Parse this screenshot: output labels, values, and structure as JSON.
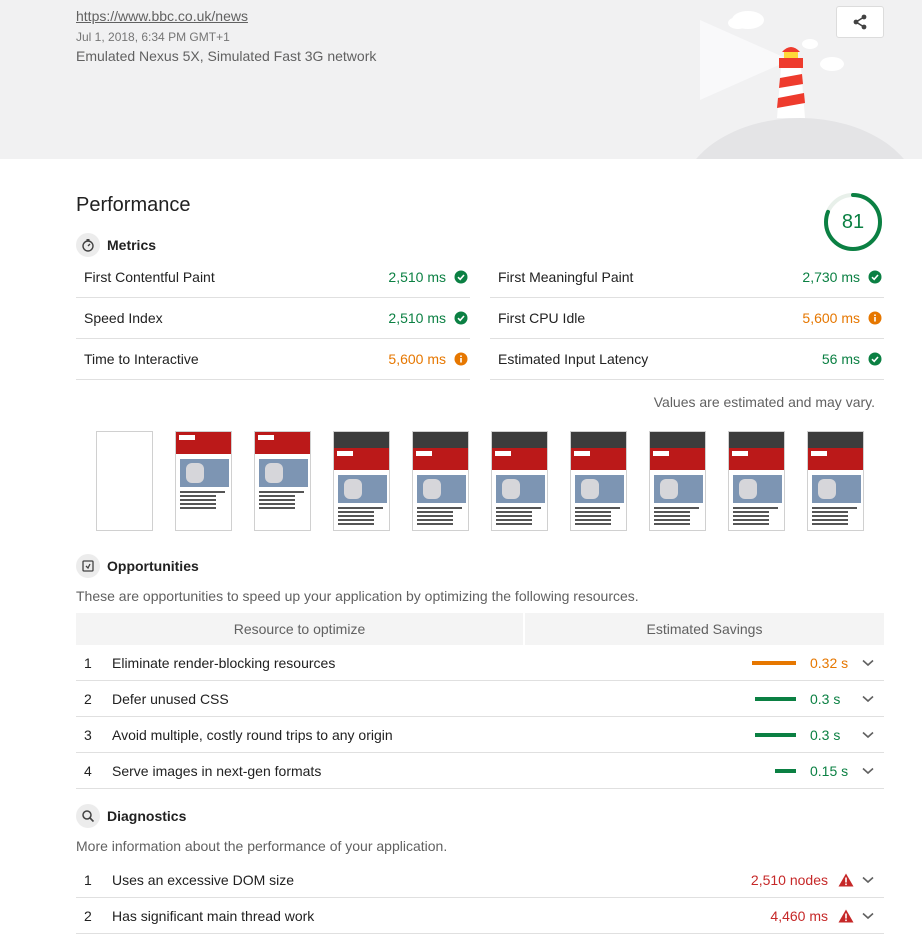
{
  "header": {
    "url": "https://www.bbc.co.uk/news",
    "date": "Jul 1, 2018, 6:34 PM GMT+1",
    "environment": "Emulated Nexus 5X, Simulated Fast 3G network"
  },
  "performance": {
    "title": "Performance",
    "score": "81",
    "score_fraction": 0.81,
    "score_color": "#0b8043"
  },
  "metrics": {
    "title": "Metrics",
    "items": [
      {
        "label": "First Contentful Paint",
        "value": "2,510 ms",
        "status": "pass"
      },
      {
        "label": "First Meaningful Paint",
        "value": "2,730 ms",
        "status": "pass"
      },
      {
        "label": "Speed Index",
        "value": "2,510 ms",
        "status": "pass"
      },
      {
        "label": "First CPU Idle",
        "value": "5,600 ms",
        "status": "average"
      },
      {
        "label": "Time to Interactive",
        "value": "5,600 ms",
        "status": "average"
      },
      {
        "label": "Estimated Input Latency",
        "value": "56 ms",
        "status": "pass"
      }
    ],
    "note": "Values are estimated and may vary."
  },
  "filmstrip": {
    "frames": 10
  },
  "opportunities": {
    "title": "Opportunities",
    "description": "These are opportunities to speed up your application by optimizing the following resources.",
    "col_resource": "Resource to optimize",
    "col_savings": "Estimated Savings",
    "items": [
      {
        "index": "1",
        "label": "Eliminate render-blocking resources",
        "value": "0.32 s",
        "fraction": 1.0,
        "color": "#e67700"
      },
      {
        "index": "2",
        "label": "Defer unused CSS",
        "value": "0.3 s",
        "fraction": 0.94,
        "color": "#0b8043"
      },
      {
        "index": "3",
        "label": "Avoid multiple, costly round trips to any origin",
        "value": "0.3 s",
        "fraction": 0.94,
        "color": "#0b8043"
      },
      {
        "index": "4",
        "label": "Serve images in next-gen formats",
        "value": "0.15 s",
        "fraction": 0.47,
        "color": "#0b8043"
      }
    ]
  },
  "diagnostics": {
    "title": "Diagnostics",
    "description": "More information about the performance of your application.",
    "items": [
      {
        "index": "1",
        "label": "Uses an excessive DOM size",
        "value": "2,510 nodes"
      },
      {
        "index": "2",
        "label": "Has significant main thread work",
        "value": "4,460 ms"
      }
    ]
  },
  "colors": {
    "pass": "#0b8043",
    "average": "#e67700",
    "fail": "#c62828"
  }
}
